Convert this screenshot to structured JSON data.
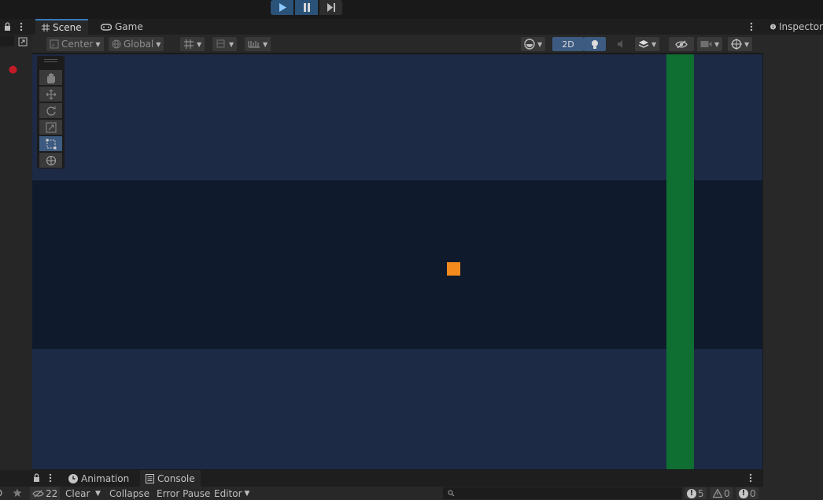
{
  "playbar": {
    "play": "▶",
    "pause": "❚❚",
    "step": "▶|"
  },
  "left_strip": {
    "lock": "🔒",
    "menu": "⋮"
  },
  "scene_tabs": [
    {
      "label": "Scene",
      "icon": "grid-icon"
    },
    {
      "label": "Game",
      "icon": "gamepad-icon"
    }
  ],
  "scene_toolbar": {
    "pivot_mode": "Center",
    "space_mode": "Global",
    "mode_2d": "2D"
  },
  "inspector": {
    "label": "Inspector",
    "icon": "info-icon"
  },
  "bottom_tabs": [
    {
      "label": "Animation",
      "icon": "clock-icon"
    },
    {
      "label": "Console",
      "icon": "list-icon"
    }
  ],
  "console_toolbar": {
    "hidden_count": "22",
    "clear": "Clear",
    "collapse": "Collapse",
    "error_pause": "Error Pause",
    "editor": "Editor",
    "log_count": "5",
    "warning_count": "0",
    "error_count": "0"
  },
  "colors": {
    "viewport_bg": "#1d2a45",
    "viewport_mid_band": "#0f1a2c",
    "green_bar": "#0f6e31",
    "player_square": "#f28a1d",
    "accent_blue": "#3a79bb"
  }
}
